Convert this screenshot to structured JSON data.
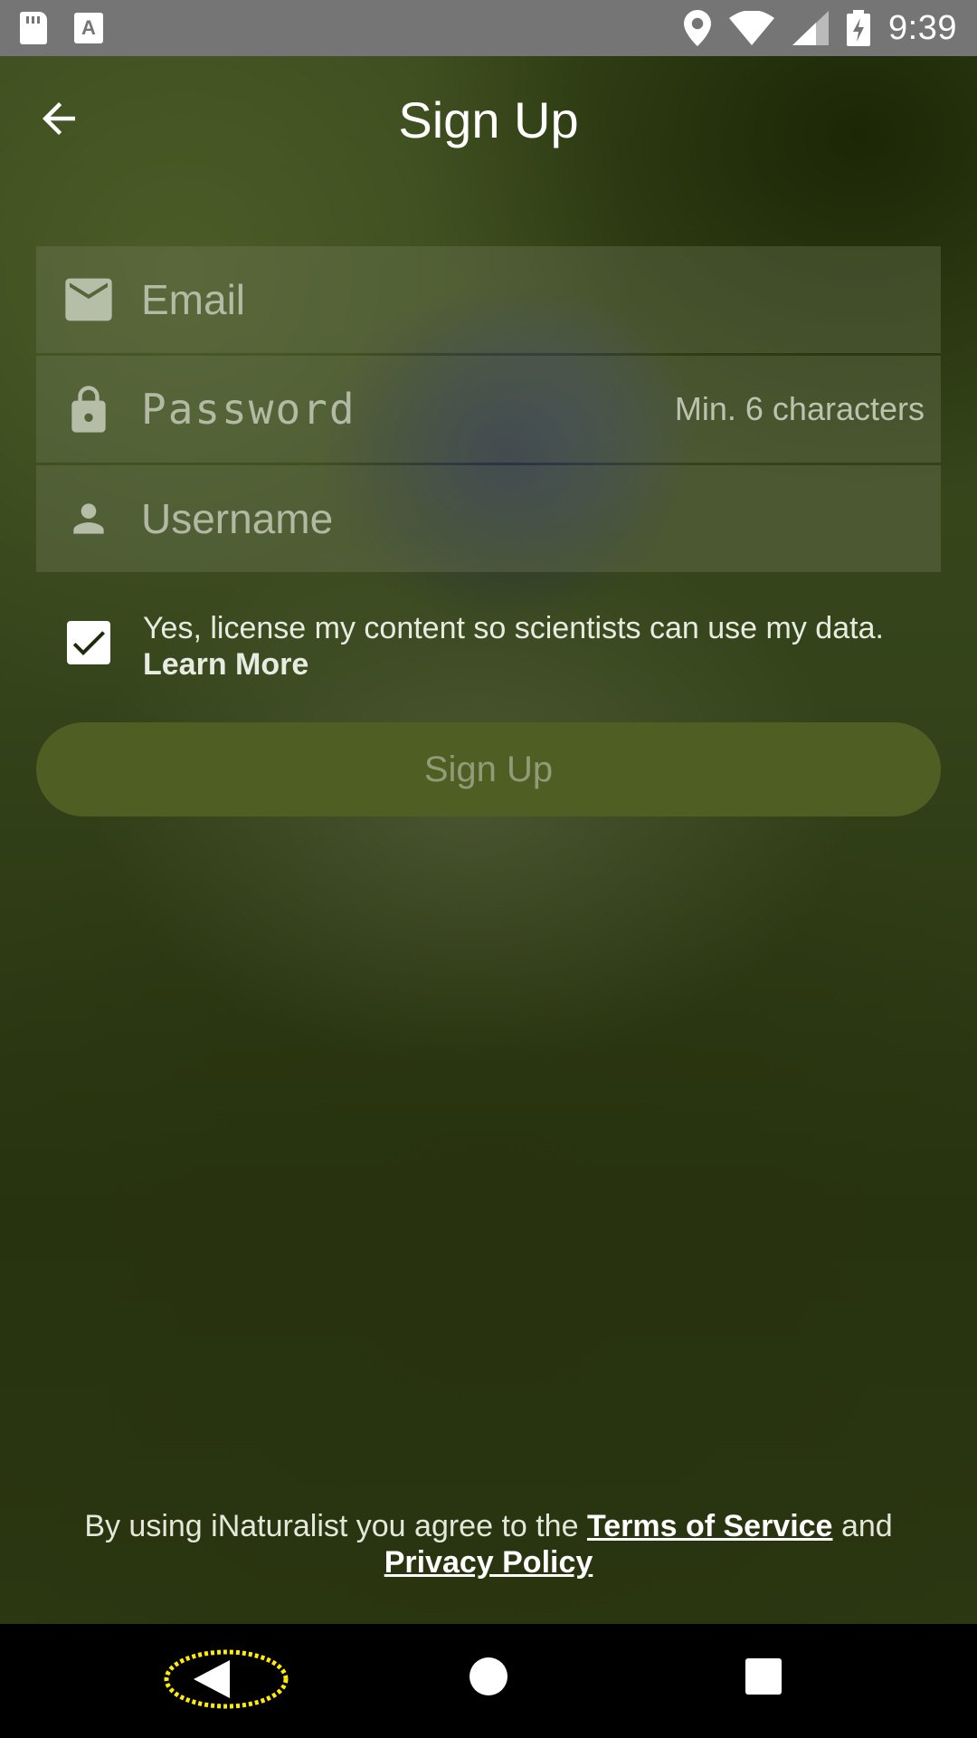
{
  "status_bar": {
    "time": "9:39",
    "icons": [
      "sd-card-icon",
      "a-notification-icon",
      "location-icon",
      "wifi-icon",
      "signal-icon",
      "battery-charging-icon"
    ]
  },
  "app_bar": {
    "title": "Sign Up",
    "back_icon": "arrow-left-icon"
  },
  "form": {
    "email": {
      "placeholder": "Email",
      "value": "",
      "icon": "mail-icon"
    },
    "password": {
      "placeholder": "Password",
      "value": "",
      "hint": "Min. 6 characters",
      "icon": "lock-icon"
    },
    "username": {
      "placeholder": "Username",
      "value": "",
      "icon": "person-icon"
    },
    "license_checkbox": {
      "checked": true,
      "label": "Yes, license my content so scientists can use my data.",
      "learn_more": "Learn More"
    },
    "submit_label": "Sign Up"
  },
  "terms": {
    "prefix": "By using iNaturalist you agree to the",
    "terms_link": "Terms of Service",
    "conjunction": "and",
    "privacy_link": "Privacy Policy"
  },
  "nav_bar": {
    "icons": [
      "nav-back-icon",
      "nav-home-icon",
      "nav-recents-icon"
    ],
    "highlight_color": "#ffee00"
  }
}
